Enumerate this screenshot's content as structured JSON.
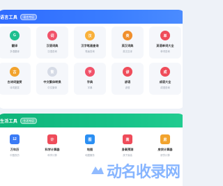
{
  "section1": {
    "title": "语言工具",
    "badge": "语言专区",
    "items": [
      {
        "name": "翻译",
        "desc": "多语翻译",
        "icon": "translate-icon",
        "color": "#1fbf8f"
      },
      {
        "name": "汉语词典",
        "desc": "汉语查询",
        "icon": "dictionary-icon",
        "color": "#f1536a"
      },
      {
        "name": "汉字笔画查询",
        "desc": "笔画查询",
        "icon": "stroke-icon",
        "color": "#f9b13b"
      },
      {
        "name": "英汉词典",
        "desc": "英汉互译",
        "icon": "english-icon",
        "color": "#f08f2c"
      },
      {
        "name": "英语单词大全",
        "desc": "单词查询",
        "icon": "words-icon",
        "color": "#ef4c5a"
      },
      {
        "name": "古诗词鉴赏",
        "desc": "诗词鉴赏",
        "icon": "poem-icon",
        "color": "#f2a32d"
      },
      {
        "name": "中文繁体转换",
        "desc": "中文繁体",
        "icon": "traditional-icon",
        "color": "#d6dbe6"
      },
      {
        "name": "字典",
        "desc": "字典",
        "icon": "char-dict-icon",
        "color": "#f1536a"
      },
      {
        "name": "谚语",
        "desc": "谚语",
        "icon": "proverb-icon",
        "color": "#ef4c5a"
      },
      {
        "name": "成语大全",
        "desc": "成语查询",
        "icon": "idiom-icon",
        "color": "#ef4c5a"
      }
    ],
    "glyphs": [
      "G",
      "词",
      "汉",
      "英",
      "单",
      "古",
      "繁",
      "字",
      "谚",
      "成"
    ]
  },
  "section2": {
    "title": "生活工具",
    "badge": "生活专区",
    "items": [
      {
        "name": "万年历",
        "desc": "中国农历",
        "icon": "calendar-icon",
        "color": "#3b7bf5"
      },
      {
        "name": "科学计算器",
        "desc": "科学计算",
        "icon": "calculator-icon",
        "color": "#ef4c5a"
      },
      {
        "name": "地图",
        "desc": "地图服务",
        "icon": "map-icon",
        "color": "#2b8ff3"
      },
      {
        "name": "身高预测",
        "desc": "孩子身高",
        "icon": "height-icon",
        "color": "#ef4c5a"
      },
      {
        "name": "房贷计算器",
        "desc": "房贷计算",
        "icon": "mortgage-icon",
        "color": "#f2a32d"
      }
    ],
    "glyphs": [
      "12",
      "计",
      "图",
      "高",
      "房"
    ]
  },
  "watermark": "动名收录网"
}
